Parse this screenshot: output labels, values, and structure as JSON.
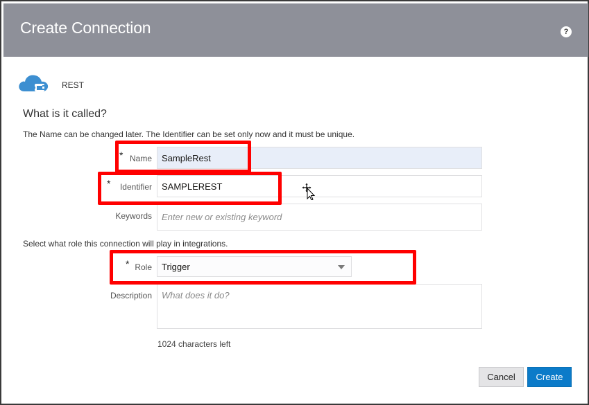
{
  "dialog": {
    "title": "Create Connection",
    "help_icon": "help-icon",
    "help_text": "?"
  },
  "adapter": {
    "icon": "cloud-rest-icon",
    "name": "REST",
    "icon_color": "#3d8fd1"
  },
  "section": {
    "title": "What is it called?",
    "hint": "The Name can be changed later. The Identifier can be set only now and it must be unique."
  },
  "fields": {
    "name": {
      "label": "Name",
      "required": "*",
      "value": "SampleRest"
    },
    "identifier": {
      "label": "Identifier",
      "required": "*",
      "value": "SAMPLEREST"
    },
    "keywords": {
      "label": "Keywords",
      "placeholder": "Enter new or existing keyword"
    },
    "role_hint": "Select what role this connection will play in integrations.",
    "role": {
      "label": "Role",
      "required": "*",
      "value": "Trigger"
    },
    "description": {
      "label": "Description",
      "placeholder": "What does it do?"
    },
    "counter": "1024 characters left"
  },
  "buttons": {
    "cancel": "Cancel",
    "create": "Create"
  },
  "colors": {
    "header": "#8e9099",
    "primary": "#0b7bc9",
    "highlight": "#ff0000"
  }
}
